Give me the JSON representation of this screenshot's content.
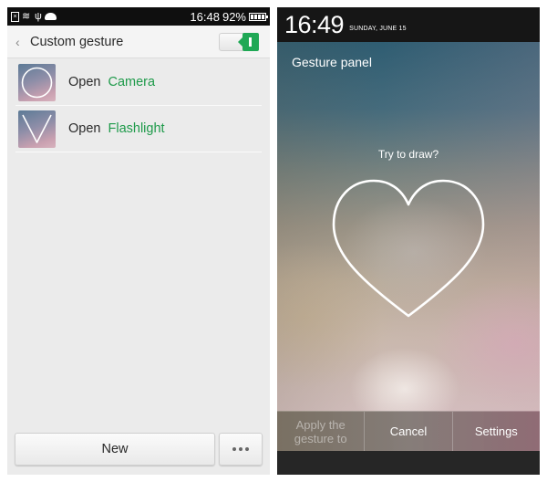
{
  "left_screen": {
    "status_bar": {
      "icons": [
        "sim-icon",
        "wifi-icon",
        "usb-icon",
        "android-debug-icon"
      ],
      "time": "16:48",
      "battery_percent": "92%",
      "battery_level": 0.92
    },
    "header": {
      "back_icon": "‹",
      "title": "Custom gesture",
      "toggle_on": true
    },
    "gestures": [
      {
        "shape": "circle",
        "action": "Open",
        "target": "Camera"
      },
      {
        "shape": "v",
        "action": "Open",
        "target": "Flashlight"
      }
    ],
    "bottom": {
      "new_label": "New",
      "more_icon": "more-dots-icon"
    },
    "colors": {
      "accent_green": "#1e9a4a",
      "toggle_green": "#1fa855"
    }
  },
  "right_screen": {
    "clock": "16:49",
    "date": "SUNDAY, JUNE 15",
    "panel_title": "Gesture panel",
    "hint": "Try to draw?",
    "demo_shape": "heart",
    "actions": [
      {
        "label": "Apply the gesture to",
        "enabled": false
      },
      {
        "label": "Cancel",
        "enabled": true
      },
      {
        "label": "Settings",
        "enabled": true
      }
    ]
  }
}
